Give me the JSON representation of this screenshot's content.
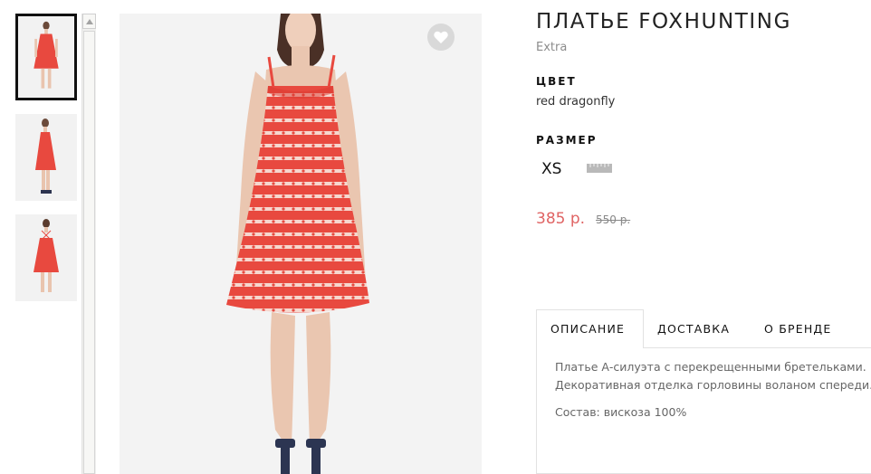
{
  "product": {
    "title": "ПЛАТЬЕ FOXHUNTING",
    "brand": "Extra",
    "color_label": "ЦВЕТ",
    "color_value": "red dragonfly",
    "size_label": "РАЗМЕР",
    "sizes": [
      "XS"
    ],
    "price": "385 р.",
    "old_price": "550 р."
  },
  "tabs": {
    "description": "ОПИСАНИЕ",
    "delivery": "ДОСТАВКА",
    "about_brand": "О БРЕНДЕ",
    "active": "description"
  },
  "description": {
    "line1": "Платье А-силуэта с перекрещенными бретельками.",
    "line2": "Декоративная отделка горловины воланом спереди.",
    "composition": "Состав: вискоза 100%"
  },
  "icons": {
    "favorite": "heart-icon",
    "size_guide": "ruler-icon",
    "scroll_up": "arrow-up-icon"
  },
  "colors": {
    "price": "#e06464",
    "dress": "#e8493f",
    "favorite_bg": "#d9d9d9"
  }
}
